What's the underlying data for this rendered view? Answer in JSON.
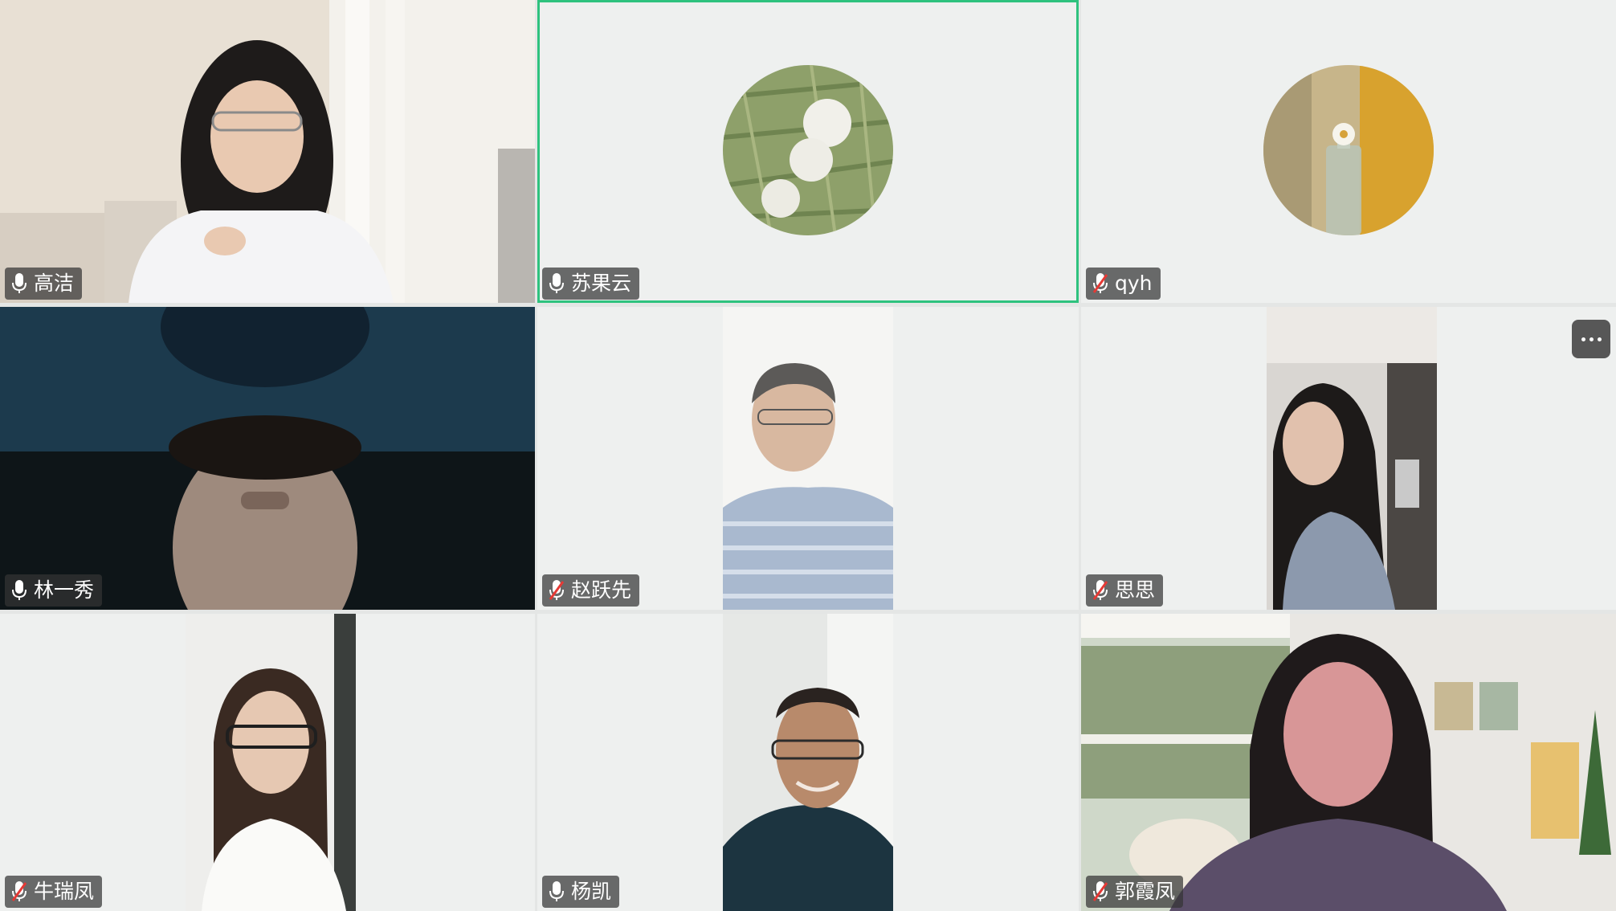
{
  "meeting": {
    "participants": [
      {
        "name": "高洁",
        "muted": false,
        "video": "camera"
      },
      {
        "name": "苏果云",
        "muted": false,
        "video": "avatar-dandelion",
        "active_speaker": true
      },
      {
        "name": "qyh",
        "muted": true,
        "video": "avatar-flower-vase"
      },
      {
        "name": "林一秀",
        "muted": false,
        "video": "camera"
      },
      {
        "name": "赵跃先",
        "muted": true,
        "video": "camera"
      },
      {
        "name": "思思",
        "muted": true,
        "video": "camera"
      },
      {
        "name": "牛瑞凤",
        "muted": true,
        "video": "camera"
      },
      {
        "name": "杨凯",
        "muted": false,
        "video": "camera"
      },
      {
        "name": "郭霞凤",
        "muted": true,
        "video": "camera"
      }
    ]
  },
  "controls": {
    "more_icon": "more-horizontal-icon"
  },
  "colors": {
    "active_speaker_border": "#2ec27e",
    "name_tag_bg": "#343434",
    "tile_bg": "#eef0ef",
    "mute_slash": "#e53935"
  }
}
